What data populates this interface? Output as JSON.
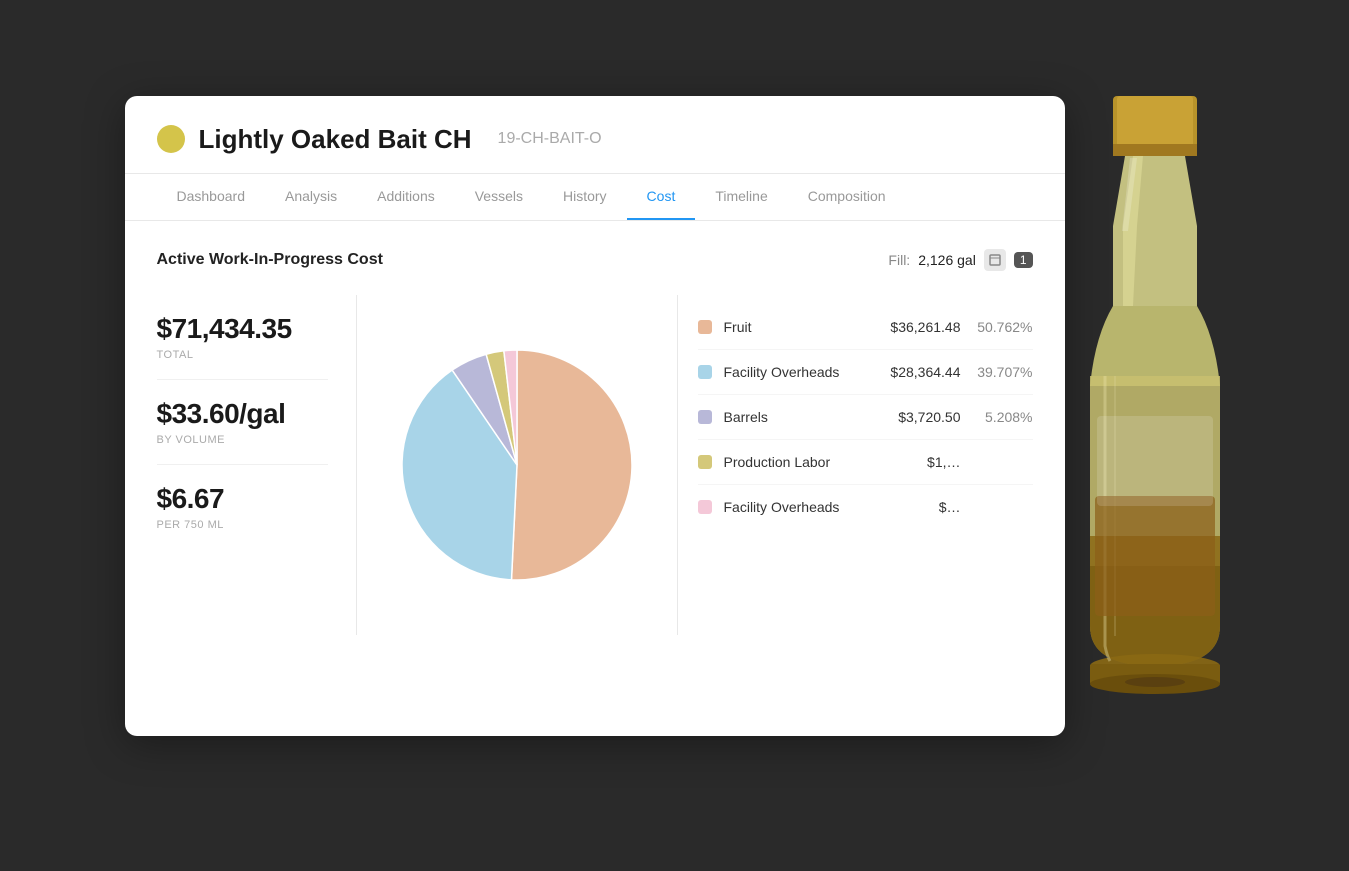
{
  "header": {
    "dot_color": "#d4c44a",
    "wine_name": "Lightly Oaked Bait CH",
    "wine_id": "19-CH-BAIT-O"
  },
  "nav": {
    "tabs": [
      {
        "label": "Dashboard",
        "active": false
      },
      {
        "label": "Analysis",
        "active": false
      },
      {
        "label": "Additions",
        "active": false
      },
      {
        "label": "Vessels",
        "active": false
      },
      {
        "label": "History",
        "active": false
      },
      {
        "label": "Cost",
        "active": true
      },
      {
        "label": "Timeline",
        "active": false
      },
      {
        "label": "Composition",
        "active": false
      }
    ]
  },
  "section": {
    "title": "Active Work-In-Progress Cost",
    "fill_label": "Fill:",
    "fill_value": "2,126 gal",
    "fill_count": "1"
  },
  "stats": [
    {
      "amount": "$71,434.35",
      "label": "TOTAL"
    },
    {
      "amount": "$33.60/gal",
      "label": "BY VOLUME"
    },
    {
      "amount": "$6.67",
      "label": "PER 750 mL"
    }
  ],
  "legend": [
    {
      "name": "Fruit",
      "amount": "$36,261.48",
      "pct": "50.762%",
      "color": "#e8b898"
    },
    {
      "name": "Facility Overheads",
      "amount": "$28,364.44",
      "pct": "39.707%",
      "color": "#a8d4e8"
    },
    {
      "name": "Barrels",
      "amount": "$3,720.50",
      "pct": "5.208%",
      "color": "#b8b8d8"
    },
    {
      "name": "Production Labor",
      "amount": "$1,…",
      "pct": "",
      "color": "#d4c87a"
    },
    {
      "name": "Facility Overheads",
      "amount": "$…",
      "pct": "",
      "color": "#f4c8d8"
    }
  ],
  "pie": {
    "segments": [
      {
        "color": "#e8b898",
        "pct": 50.762,
        "label": "Fruit"
      },
      {
        "color": "#a8d4e8",
        "pct": 39.707,
        "label": "Facility Overheads"
      },
      {
        "color": "#b8b8d8",
        "pct": 5.208,
        "label": "Barrels"
      },
      {
        "color": "#d4c87a",
        "pct": 2.5,
        "label": "Production Labor"
      },
      {
        "color": "#f4c8d8",
        "pct": 1.823,
        "label": "Facility Overheads 2"
      }
    ]
  }
}
